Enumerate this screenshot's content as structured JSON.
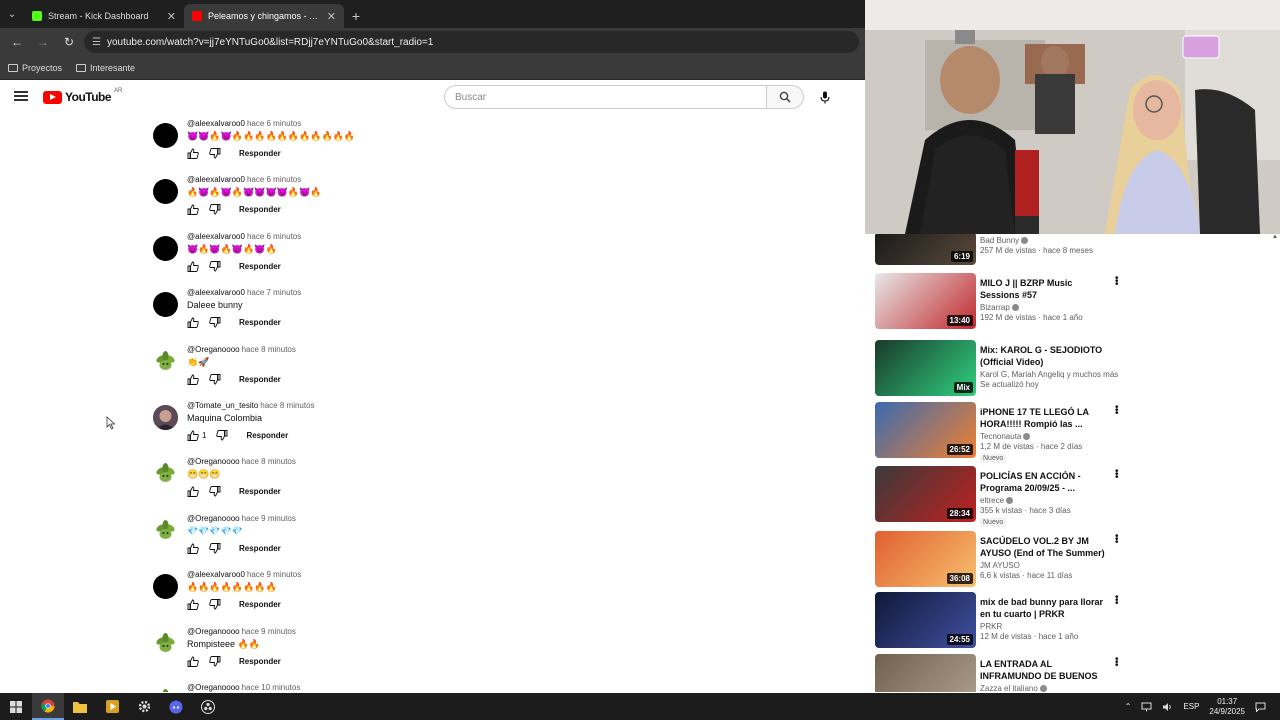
{
  "browser": {
    "tabs": [
      {
        "title": "Stream - Kick Dashboard",
        "favicon_color": "#53fc18",
        "active": false
      },
      {
        "title": "Peleamos y chingamos - Teo ru...",
        "favicon_color": "#ff0000",
        "active": true
      }
    ],
    "url": "youtube.com/watch?v=jj7eYNTuGo0&list=RDjj7eYNTuGo0&start_radio=1",
    "bookmarks": [
      "Proyectos",
      "Interesante"
    ]
  },
  "youtube": {
    "logo_text": "YouTube",
    "country_code": "AR",
    "search_placeholder": "Buscar"
  },
  "comments": [
    {
      "author": "@aleexalvaroo0",
      "time": "hace 6 minutos",
      "text": "😈😈🔥😈🔥🔥🔥🔥🔥🔥🔥🔥🔥🔥🔥",
      "likes": "",
      "reply": "Responder",
      "avatar": "black"
    },
    {
      "author": "@aleexalvaroo0",
      "time": "hace 6 minutos",
      "text": "🔥😈🔥😈🔥😈😈😈😈🔥😈🔥",
      "likes": "",
      "reply": "Responder",
      "avatar": "black"
    },
    {
      "author": "@aleexalvaroo0",
      "time": "hace 6 minutos",
      "text": "😈🔥😈🔥😈🔥😈🔥",
      "likes": "",
      "reply": "Responder",
      "avatar": "black"
    },
    {
      "author": "@aleexalvaroo0",
      "time": "hace 7 minutos",
      "text": "Daleee bunny",
      "likes": "",
      "reply": "Responder",
      "avatar": "black"
    },
    {
      "author": "@Oreganoooo",
      "time": "hace 8 minutos",
      "text": "👏🚀",
      "likes": "",
      "reply": "Responder",
      "avatar": "plant"
    },
    {
      "author": "@Tomate_un_tesito",
      "time": "hace 8 minutos",
      "text": "Maquina Colombia",
      "likes": "1",
      "reply": "Responder",
      "avatar": "tom"
    },
    {
      "author": "@Oreganoooo",
      "time": "hace 8 minutos",
      "text": "😁😁😁",
      "likes": "",
      "reply": "Responder",
      "avatar": "plant"
    },
    {
      "author": "@Oreganoooo",
      "time": "hace 9 minutos",
      "text": "💎💎💎💎💎",
      "likes": "",
      "reply": "Responder",
      "avatar": "plant"
    },
    {
      "author": "@aleexalvaroo0",
      "time": "hace 9 minutos",
      "text": "🔥🔥🔥🔥🔥🔥🔥🔥",
      "likes": "",
      "reply": "Responder",
      "avatar": "black"
    },
    {
      "author": "@Oreganoooo",
      "time": "hace 9 minutos",
      "text": "Rompisteee 🔥🔥",
      "likes": "",
      "reply": "Responder",
      "avatar": "plant"
    },
    {
      "author": "@Oreganoooo",
      "time": "hace 10 minutos",
      "text": "",
      "likes": "",
      "reply": "",
      "avatar": "plant"
    }
  ],
  "recommendations": [
    {
      "title": "",
      "channel": "Bad Bunny",
      "verified": true,
      "stats": "257 M de vistas · hace 8 meses",
      "duration": "6:19",
      "badge": "",
      "thumb": [
        "#1a1a1a",
        "#5a4a3a"
      ]
    },
    {
      "title": "MILO J || BZRP Music Sessions #57",
      "channel": "Bizarrap",
      "verified": true,
      "stats": "192 M de vistas · hace 1 año",
      "duration": "13:40",
      "badge": "",
      "thumb": [
        "#e8e8e8",
        "#c0282c"
      ]
    },
    {
      "title": "Mix: KAROL G - SEJODIOTO (Official Video)",
      "channel": "Karol G, Mariah Angeliq y muchos más",
      "verified": false,
      "stats": "Se actualizó hoy",
      "duration": "Mix",
      "badge": "",
      "thumb": [
        "#1a3a2a",
        "#2fd080"
      ]
    },
    {
      "title": "iPHONE 17 TE LLEGÓ LA HORA!!!!! Rompió las ...",
      "channel": "Tecnonauta",
      "verified": true,
      "stats": "1,2 M de vistas · hace 2 días",
      "duration": "26:52",
      "badge": "Nuevo",
      "thumb": [
        "#3a6ab0",
        "#f08030"
      ]
    },
    {
      "title": "POLICÍAS EN ACCIÓN - Programa 20/09/25 - ...",
      "channel": "eltrece",
      "verified": true,
      "stats": "355 k vistas · hace 3 días",
      "duration": "28:34",
      "badge": "Nuevo",
      "thumb": [
        "#3a3a3a",
        "#c02020"
      ]
    },
    {
      "title": "SACÚDELO VOL.2 BY JM AYUSO (End of The Summer)",
      "channel": "JM AYUSO",
      "verified": false,
      "stats": "6,6 k vistas · hace 11 días",
      "duration": "36:08",
      "badge": "",
      "thumb": [
        "#e06030",
        "#f8c070"
      ]
    },
    {
      "title": "mix de bad bunny para llorar en tu cuarto | PRKR",
      "channel": "PRKR",
      "verified": false,
      "stats": "12 M de vistas · hace 1 año",
      "duration": "24:55",
      "badge": "",
      "thumb": [
        "#101838",
        "#4050a0"
      ]
    },
    {
      "title": "LA ENTRADA AL INFRAMUNDO DE BUENOS AIRES - ¡Aquí NO ...",
      "channel": "Zazza el italiano",
      "verified": true,
      "stats": "",
      "duration": "",
      "badge": "",
      "thumb": [
        "#706050",
        "#b0a090"
      ]
    }
  ],
  "taskbar": {
    "lang": "ESP",
    "time": "01:37",
    "date": "24/9/2025"
  }
}
